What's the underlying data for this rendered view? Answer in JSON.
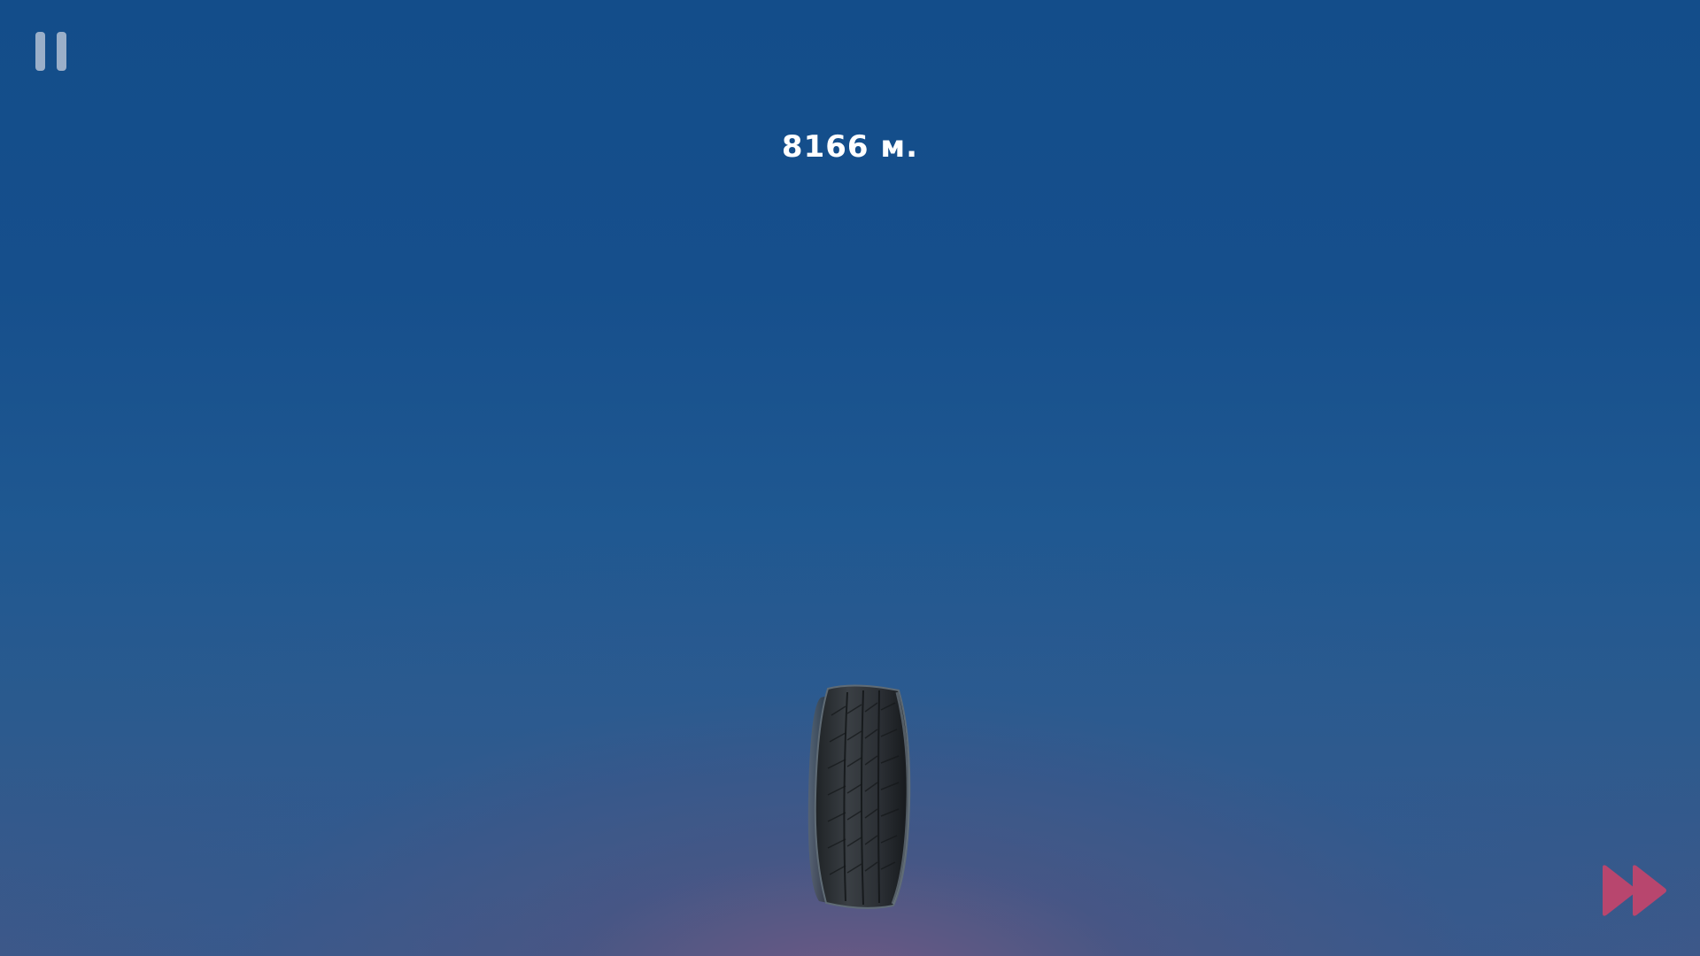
{
  "hud": {
    "distance_text": "8166 м."
  },
  "controls": {
    "pause_icon": "pause-icon",
    "fast_forward_icon": "fast-forward-icon"
  },
  "colors": {
    "sky_top": "#134d8a",
    "sky_bottom_glow": "#6a5a80",
    "fast_forward": "#b8466e",
    "pause": "#c8d0de"
  }
}
